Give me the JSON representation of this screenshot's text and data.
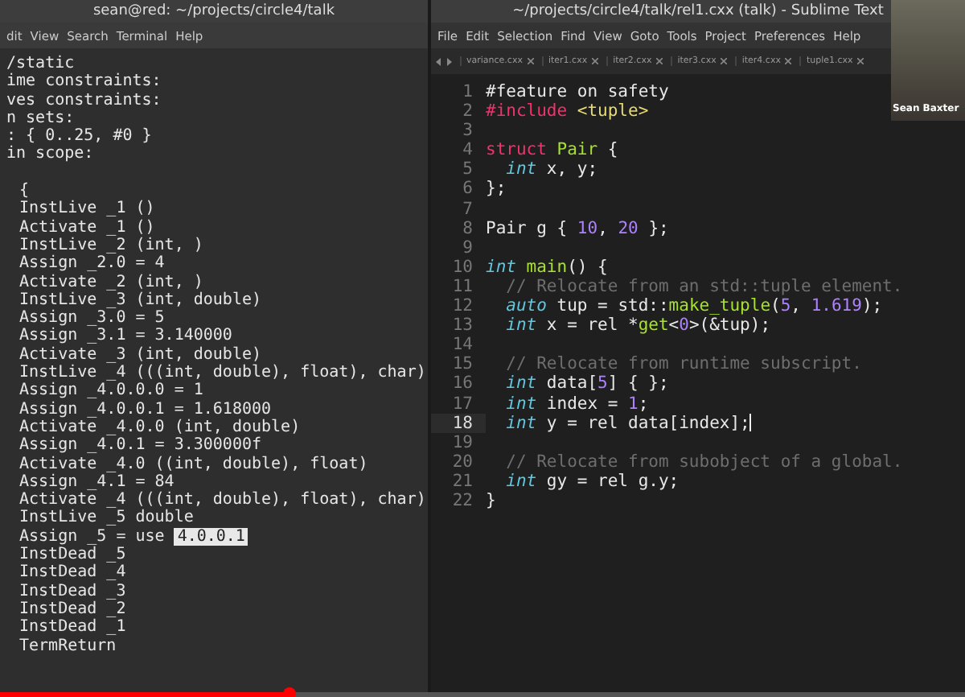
{
  "terminal": {
    "title": "sean@red: ~/projects/circle4/talk",
    "menu": [
      "dit",
      "View",
      "Search",
      "Terminal",
      "Help"
    ],
    "header_lines": [
      "/static",
      "ime constraints:",
      "ves constraints:",
      "n sets:",
      ": { 0..25, #0 }",
      "in scope:"
    ],
    "trace_lines": [
      {
        "text": "{"
      },
      {
        "text": "InstLive _1 ()"
      },
      {
        "text": "Activate _1 ()"
      },
      {
        "text": "InstLive _2 (int, )"
      },
      {
        "text": "Assign _2.0 = 4"
      },
      {
        "text": "Activate _2 (int, )"
      },
      {
        "text": "InstLive _3 (int, double)"
      },
      {
        "text": "Assign _3.0 = 5"
      },
      {
        "text": "Assign _3.1 = 3.140000"
      },
      {
        "text": "Activate _3 (int, double)"
      },
      {
        "text": "InstLive _4 (((int, double), float), char)"
      },
      {
        "text": "Assign _4.0.0.0 = 1"
      },
      {
        "text": "Assign _4.0.0.1 = 1.618000"
      },
      {
        "text": "Activate _4.0.0 (int, double)"
      },
      {
        "text": "Assign _4.0.1 = 3.300000f"
      },
      {
        "text": "Activate _4.0 ((int, double), float)"
      },
      {
        "text": "Assign _4.1 = 84"
      },
      {
        "text": "Activate _4 (((int, double), float), char)"
      },
      {
        "text": "InstLive _5 double"
      },
      {
        "text": "Assign _5 = use",
        "selection": "4.0.0.1"
      },
      {
        "text": "InstDead _5"
      },
      {
        "text": "InstDead _4"
      },
      {
        "text": "InstDead _3"
      },
      {
        "text": "InstDead _2"
      },
      {
        "text": "InstDead _1"
      },
      {
        "text": "TermReturn"
      }
    ]
  },
  "editor": {
    "title": "~/projects/circle4/talk/rel1.cxx (talk) - Sublime Text",
    "menu": [
      "File",
      "Edit",
      "Selection",
      "Find",
      "View",
      "Goto",
      "Tools",
      "Project",
      "Preferences",
      "Help"
    ],
    "tabs": [
      "variance.cxx",
      "iter1.cxx",
      "iter2.cxx",
      "iter3.cxx",
      "iter4.cxx",
      "tuple1.cxx"
    ],
    "lines": [
      {
        "number": "1",
        "current": false,
        "tokens": [
          {
            "t": "#feature on safety",
            "kind": "plain"
          }
        ]
      },
      {
        "number": "2",
        "current": false,
        "tokens": [
          {
            "t": "#include",
            "kind": "keyword"
          },
          {
            "t": " <tuple>",
            "kind": "string"
          }
        ]
      },
      {
        "number": "3",
        "current": false
      },
      {
        "number": "4",
        "current": false,
        "tokens": [
          {
            "t": "struct",
            "kind": "keyword"
          },
          {
            "t": " Pair",
            "kind": "func"
          },
          {
            "t": " {",
            "kind": "plain"
          }
        ]
      },
      {
        "number": "5",
        "current": false,
        "tokens": [
          {
            "t": "  int",
            "kind": "type"
          },
          {
            "t": " x, y;",
            "kind": "plain"
          }
        ]
      },
      {
        "number": "6",
        "current": false,
        "tokens": [
          {
            "t": "};",
            "kind": "plain"
          }
        ]
      },
      {
        "number": "7",
        "current": false
      },
      {
        "number": "8",
        "current": false,
        "tokens": [
          {
            "t": "Pair g { ",
            "kind": "plain"
          },
          {
            "t": "10",
            "kind": "number"
          },
          {
            "t": ", ",
            "kind": "plain"
          },
          {
            "t": "20",
            "kind": "number"
          },
          {
            "t": " };",
            "kind": "plain"
          }
        ]
      },
      {
        "number": "9",
        "current": false
      },
      {
        "number": "10",
        "current": false,
        "tokens": [
          {
            "t": "int",
            "kind": "type"
          },
          {
            "t": " main",
            "kind": "func"
          },
          {
            "t": "() {",
            "kind": "plain"
          }
        ]
      },
      {
        "number": "11",
        "current": false,
        "tokens": [
          {
            "t": "  // Relocate from an std::tuple element.",
            "kind": "comment"
          }
        ]
      },
      {
        "number": "12",
        "current": false,
        "tokens": [
          {
            "t": "  auto",
            "kind": "type"
          },
          {
            "t": " tup = std::",
            "kind": "plain"
          },
          {
            "t": "make_tuple",
            "kind": "func"
          },
          {
            "t": "(",
            "kind": "plain"
          },
          {
            "t": "5",
            "kind": "number"
          },
          {
            "t": ", ",
            "kind": "plain"
          },
          {
            "t": "1.619",
            "kind": "number"
          },
          {
            "t": ");",
            "kind": "plain"
          }
        ]
      },
      {
        "number": "13",
        "current": false,
        "tokens": [
          {
            "t": "  int",
            "kind": "type"
          },
          {
            "t": " x = rel *",
            "kind": "plain"
          },
          {
            "t": "get",
            "kind": "func"
          },
          {
            "t": "<",
            "kind": "plain"
          },
          {
            "t": "0",
            "kind": "number"
          },
          {
            "t": ">(&tup);",
            "kind": "plain"
          }
        ]
      },
      {
        "number": "14",
        "current": false
      },
      {
        "number": "15",
        "current": false,
        "tokens": [
          {
            "t": "  // Relocate from runtime subscript.",
            "kind": "comment"
          }
        ]
      },
      {
        "number": "16",
        "current": false,
        "tokens": [
          {
            "t": "  int",
            "kind": "type"
          },
          {
            "t": " data[",
            "kind": "plain"
          },
          {
            "t": "5",
            "kind": "number"
          },
          {
            "t": "] { };",
            "kind": "plain"
          }
        ]
      },
      {
        "number": "17",
        "current": false,
        "tokens": [
          {
            "t": "  int",
            "kind": "type"
          },
          {
            "t": " index = ",
            "kind": "plain"
          },
          {
            "t": "1",
            "kind": "number"
          },
          {
            "t": ";",
            "kind": "plain"
          }
        ]
      },
      {
        "number": "18",
        "current": true,
        "tokens": [
          {
            "t": "  int",
            "kind": "type"
          },
          {
            "t": " y = rel data[index];",
            "kind": "plain"
          }
        ]
      },
      {
        "number": "19",
        "current": false
      },
      {
        "number": "20",
        "current": false,
        "tokens": [
          {
            "t": "  // Relocate from subobject of a global.",
            "kind": "comment"
          }
        ]
      },
      {
        "number": "21",
        "current": false,
        "tokens": [
          {
            "t": "  int",
            "kind": "type"
          },
          {
            "t": " gy = rel g.y;",
            "kind": "plain"
          }
        ]
      },
      {
        "number": "22",
        "current": false,
        "tokens": [
          {
            "t": "}",
            "kind": "plain"
          }
        ]
      }
    ]
  },
  "webcam": {
    "name": "Sean Baxter"
  },
  "video_progress": {
    "level": 0.3
  }
}
